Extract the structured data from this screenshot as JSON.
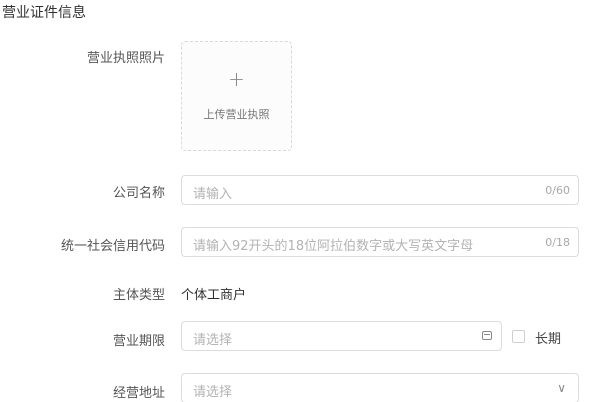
{
  "section": {
    "title": "营业证件信息"
  },
  "license_photo": {
    "label": "营业执照照片",
    "plus": "+",
    "upload_text": "上传营业执照"
  },
  "company_name": {
    "label": "公司名称",
    "placeholder": "请输入",
    "counter": "0/60"
  },
  "credit_code": {
    "label": "统一社会信用代码",
    "placeholder": "请输入92开头的18位阿拉伯数字或大写英文字母",
    "counter": "0/18"
  },
  "entity_type": {
    "label": "主体类型",
    "value": "个体工商户"
  },
  "business_term": {
    "label": "营业期限",
    "placeholder": "请选择",
    "icon": "calendar-icon",
    "checkbox_label": "长期"
  },
  "business_address": {
    "label": "经营地址",
    "placeholder": "请选择",
    "icon": "chevron-down-icon"
  }
}
